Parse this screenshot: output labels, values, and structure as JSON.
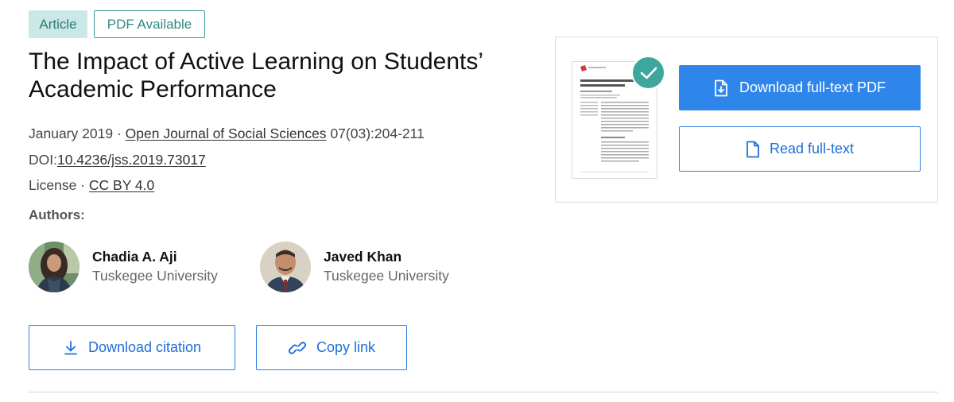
{
  "tags": {
    "article": "Article",
    "pdf": "PDF Available"
  },
  "title": "The Impact of Active Learning on Students’ Academic Performance",
  "meta": {
    "date": "January 2019",
    "separator": "·",
    "journal": "Open Journal of Social Sciences",
    "volume": "07(03):204-211",
    "doi_label": "DOI:",
    "doi": "10.4236/jss.2019.73017",
    "license_label": "License",
    "license": "CC BY 4.0"
  },
  "authors_heading": "Authors:",
  "authors": [
    {
      "name": "Chadia A. Aji",
      "affiliation": "Tuskegee University"
    },
    {
      "name": "Javed Khan",
      "affiliation": "Tuskegee University"
    }
  ],
  "actions": {
    "download_citation": "Download citation",
    "copy_link": "Copy link"
  },
  "card": {
    "download_pdf": "Download full-text PDF",
    "read_fulltext": "Read full-text"
  },
  "icons": {
    "download": "download-icon",
    "link": "link-icon",
    "pdf_download": "pdf-download-icon",
    "document": "document-icon",
    "check": "check-icon"
  },
  "colors": {
    "primary": "#2f86ea",
    "accent_teal": "#3ea79d",
    "tag_bg": "#c9e8e6"
  }
}
